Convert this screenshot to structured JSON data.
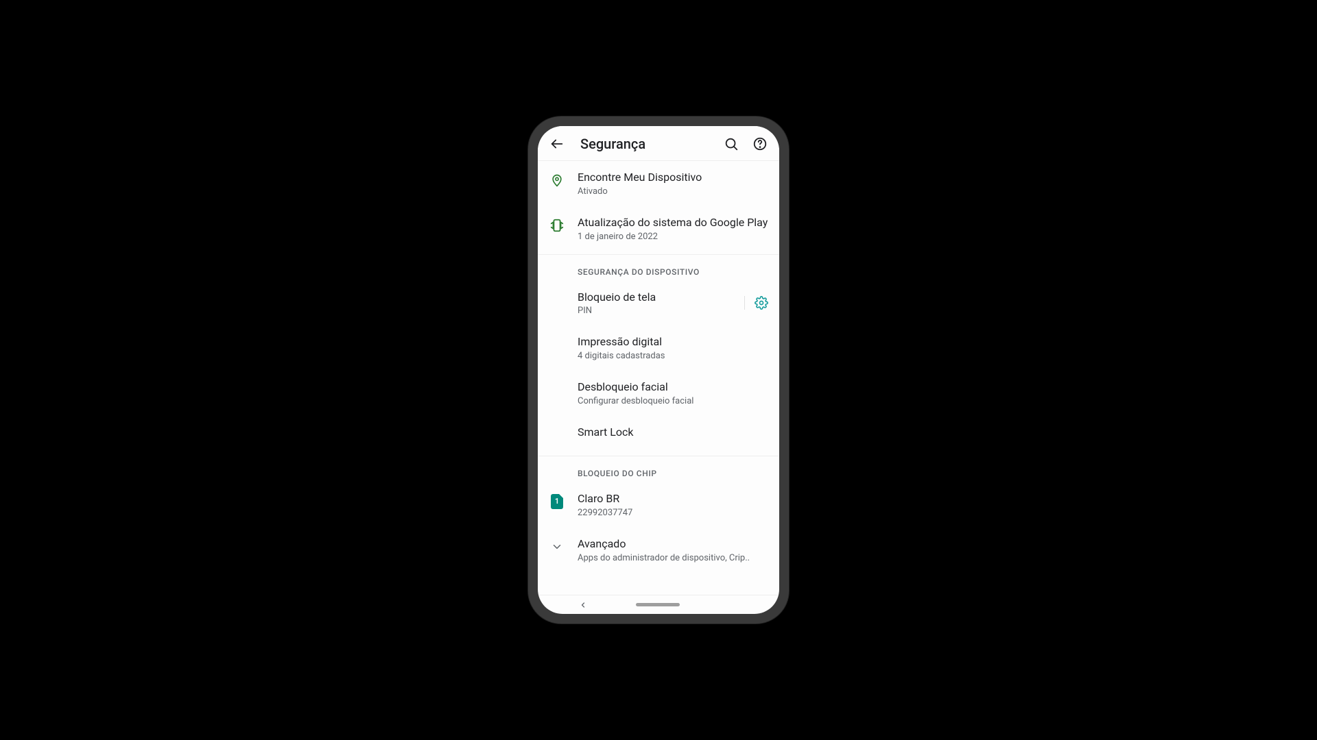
{
  "appbar": {
    "title": "Segurança"
  },
  "sections": {
    "top": {
      "find_device": {
        "title": "Encontre Meu Dispositivo",
        "subtitle": "Ativado"
      },
      "play_update": {
        "title": "Atualização do sistema do Google Play",
        "subtitle": "1 de janeiro de 2022"
      }
    },
    "device_security": {
      "header": "SEGURANÇA DO DISPOSITIVO",
      "screen_lock": {
        "title": "Bloqueio de tela",
        "subtitle": "PIN"
      },
      "fingerprint": {
        "title": "Impressão digital",
        "subtitle": "4 digitais cadastradas"
      },
      "face_unlock": {
        "title": "Desbloqueio facial",
        "subtitle": "Configurar desbloqueio facial"
      },
      "smart_lock": {
        "title": "Smart Lock"
      }
    },
    "sim_lock": {
      "header": "BLOQUEIO DO CHIP",
      "sim1": {
        "badge": "1",
        "title": "Claro BR",
        "subtitle": "22992037747"
      }
    },
    "advanced": {
      "title": "Avançado",
      "subtitle": "Apps do administrador de dispositivo, Crip.."
    }
  }
}
